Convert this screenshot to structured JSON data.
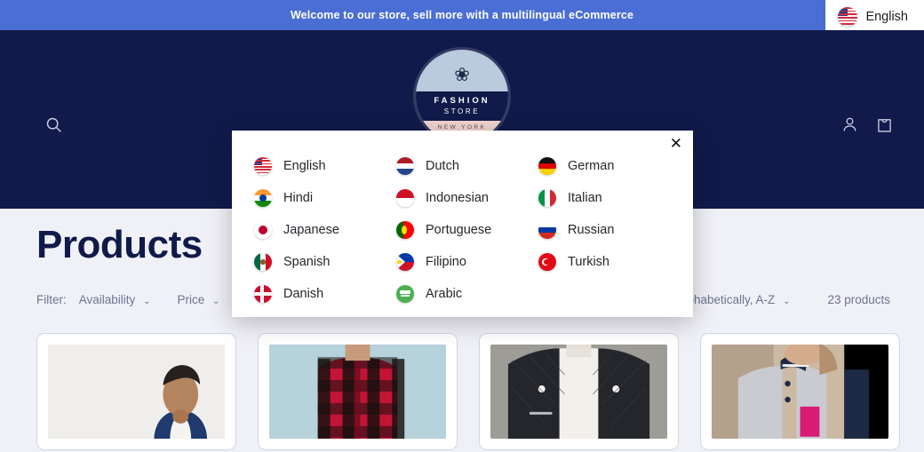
{
  "announcement": {
    "text": "Welcome to our store, sell more with a multilingual eCommerce"
  },
  "language_switcher": {
    "current": "English",
    "flag": "us-flag-icon"
  },
  "header": {
    "search_icon": "search-icon",
    "account_icon": "account-person-icon",
    "cart_icon": "shopping-bag-icon",
    "logo": {
      "sprig": "❀",
      "line1": "FASHION",
      "line2": "STORE",
      "city": "NEW YORK"
    }
  },
  "main": {
    "title": "Products",
    "filter_label": "Filter:",
    "facets": [
      {
        "label": "Availability",
        "caret": "⌄"
      },
      {
        "label": "Price",
        "caret": "⌄"
      }
    ],
    "sort_by": "lphabetically, A-Z",
    "sort_caret": "⌄",
    "product_count": "23 products",
    "cards": [
      {
        "name": "product-card-1",
        "alt": "man-in-blue-jacket-photo"
      },
      {
        "name": "product-card-2",
        "alt": "red-black-plaid-shirt-photo"
      },
      {
        "name": "product-card-3",
        "alt": "black-quilted-leather-jacket-photo"
      },
      {
        "name": "product-card-4",
        "alt": "grey-varsity-jacket-photo"
      }
    ]
  },
  "language_modal": {
    "close_label": "✕",
    "columns": [
      [
        {
          "label": "English",
          "flag": "us-flag-icon",
          "code": "f-us"
        },
        {
          "label": "Hindi",
          "flag": "india-flag-icon",
          "code": "f-in"
        },
        {
          "label": "Japanese",
          "flag": "japan-flag-icon",
          "code": "f-jp"
        },
        {
          "label": "Spanish",
          "flag": "mexico-flag-icon",
          "code": "f-mx"
        },
        {
          "label": "Danish",
          "flag": "denmark-flag-icon",
          "code": "f-dk"
        }
      ],
      [
        {
          "label": "Dutch",
          "flag": "netherlands-flag-icon",
          "code": "f-nl"
        },
        {
          "label": "Indonesian",
          "flag": "indonesia-flag-icon",
          "code": "f-id"
        },
        {
          "label": "Portuguese",
          "flag": "portugal-flag-icon",
          "code": "f-pt"
        },
        {
          "label": "Filipino",
          "flag": "philippines-flag-icon",
          "code": "f-ph"
        },
        {
          "label": "Arabic",
          "flag": "arabic-flag-icon",
          "code": "f-ar"
        }
      ],
      [
        {
          "label": "German",
          "flag": "germany-flag-icon",
          "code": "f-de"
        },
        {
          "label": "Italian",
          "flag": "italy-flag-icon",
          "code": "f-it"
        },
        {
          "label": "Russian",
          "flag": "russia-flag-icon",
          "code": "f-ru"
        },
        {
          "label": "Turkish",
          "flag": "turkey-flag-icon",
          "code": "f-tr"
        }
      ]
    ]
  },
  "colors": {
    "banner": "#4a6ed4",
    "header": "#111a4a",
    "page_bg": "#f0f1f7",
    "title": "#101a4a",
    "muted_text": "#6b7490"
  }
}
